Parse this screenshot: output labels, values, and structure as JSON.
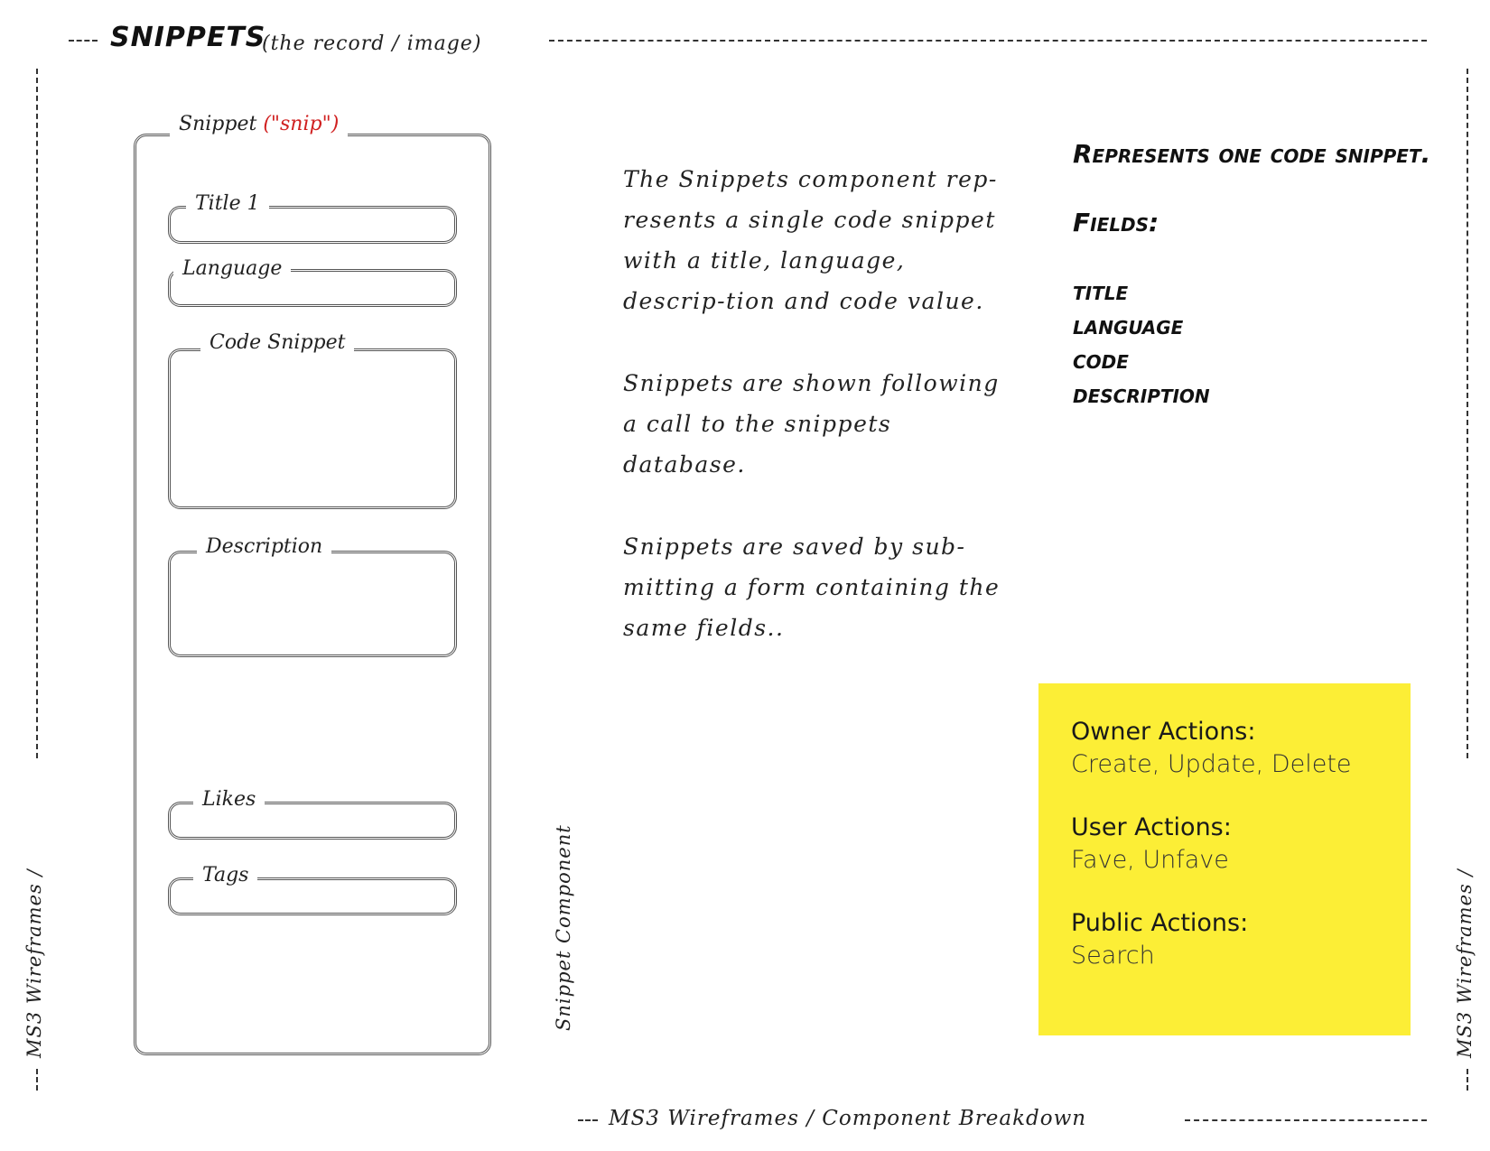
{
  "header": {
    "title": "SNIPPETS",
    "subtitle": "(the record / image)"
  },
  "wireframe": {
    "component_label": "Snippet",
    "component_alias": "(\"snip\")",
    "fields": [
      {
        "label": "Title 1"
      },
      {
        "label": "Language"
      },
      {
        "label": "Code Snippet"
      },
      {
        "label": "Description"
      },
      {
        "label": "Likes"
      },
      {
        "label": "Tags"
      }
    ]
  },
  "vertical_label": "Snippet Component",
  "margin_label": "MS3 Wireframes /",
  "description": {
    "paragraphs": [
      "The Snippets component rep-resents a single code snippet with a title, language, descrip-tion and code value.",
      "Snippets are shown following a call to the snippets database.",
      "Snippets are saved by sub-mitting a form containing the same fields.."
    ]
  },
  "summary": {
    "headline": "Represents one code snippet.",
    "fields_heading": "Fields:",
    "fields": [
      "title",
      "language",
      "code",
      "description"
    ]
  },
  "actions": {
    "owner": {
      "title": "Owner Actions:",
      "values": "Create, Update, Delete"
    },
    "user": {
      "title": "User Actions:",
      "values": "Fave, Unfave"
    },
    "public": {
      "title": "Public Actions:",
      "values": "Search"
    }
  },
  "footer": "MS3 Wireframes / Component Breakdown",
  "colors": {
    "highlight": "#fcee36",
    "accent": "#d02020",
    "ink": "#222222"
  }
}
